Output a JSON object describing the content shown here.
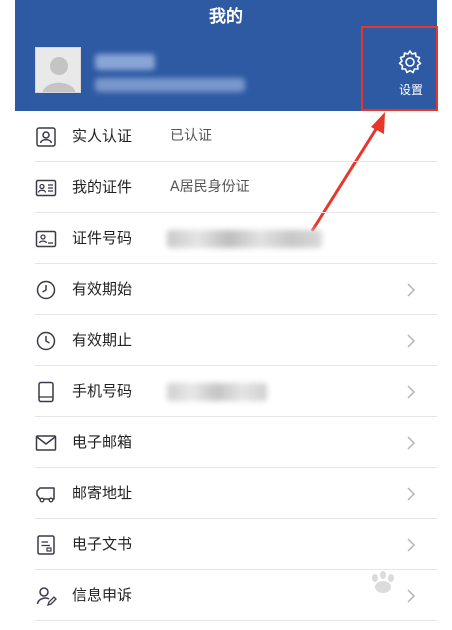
{
  "header": {
    "title": "我的",
    "settings_label": "设置"
  },
  "profile": {
    "avatar": "avatar-icon"
  },
  "rows": [
    {
      "label": "实人认证",
      "value": "已认证",
      "icon": "id-card-icon",
      "chevron": false
    },
    {
      "label": "我的证件",
      "value": "A居民身份证",
      "icon": "document-icon",
      "chevron": false
    },
    {
      "label": "证件号码",
      "value": "",
      "icon": "id-number-icon",
      "chevron": false
    },
    {
      "label": "有效期始",
      "value": "",
      "icon": "clock-icon",
      "chevron": true
    },
    {
      "label": "有效期止",
      "value": "",
      "icon": "clock-icon",
      "chevron": true
    },
    {
      "label": "手机号码",
      "value": "",
      "icon": "phone-icon",
      "chevron": true
    },
    {
      "label": "电子邮箱",
      "value": "",
      "icon": "mail-icon",
      "chevron": true
    },
    {
      "label": "邮寄地址",
      "value": "",
      "icon": "truck-icon",
      "chevron": true
    },
    {
      "label": "电子文书",
      "value": "",
      "icon": "paper-icon",
      "chevron": true
    },
    {
      "label": "信息申诉",
      "value": "",
      "icon": "user-edit-icon",
      "chevron": true
    }
  ],
  "colors": {
    "header_bg": "#2d5aa3",
    "accent": "#e8372a"
  }
}
